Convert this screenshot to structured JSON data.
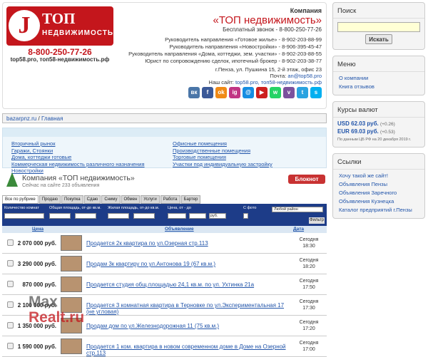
{
  "logo": {
    "top": "ТОП",
    "sub": "НЕДВИЖИМОСТЬ",
    "phone": "8-800-250-77-26",
    "sites": "top58.pro, топ58-недвижимость.рф"
  },
  "header": {
    "company_label": "Компания",
    "company_name": "«ТОП недвижимость»",
    "free_call": "Бесплатный звонок - 8-800-250-77-26",
    "staff": [
      "Руководитель направления «Готовое жилье» - 8-902-203-88-99",
      "Руководитель направления «Новостройки» - 8-906-395-45-47",
      "Руководитель направления «Дома, коттеджи, зем. участки» - 8-902-203-88-55",
      "Юрист по сопровождению сделок, ипотечный брокер - 8-902-203-38-77"
    ],
    "address": "г.Пенза, ул. Пушкина 15, 2-й этаж, офис 23",
    "mail_label": "Почта:",
    "mail": "an@top58.pro",
    "sites_label": "Наш сайт:",
    "sites": "top58.pro, топ58-недвижимость.рф",
    "social": [
      {
        "icon": "vk-icon",
        "label": "вк",
        "color": "#4a76a8"
      },
      {
        "icon": "facebook-icon",
        "label": "f",
        "color": "#3b5998"
      },
      {
        "icon": "odnoklassniki-icon",
        "label": "ok",
        "color": "#f08a16"
      },
      {
        "icon": "instagram-icon",
        "label": "ig",
        "color": "#c13584"
      },
      {
        "icon": "moimir-icon",
        "label": "@",
        "color": "#168de2"
      },
      {
        "icon": "youtube-icon",
        "label": "▶",
        "color": "#cd201f"
      },
      {
        "icon": "whatsapp-icon",
        "label": "w",
        "color": "#25d366"
      },
      {
        "icon": "viber-icon",
        "label": "v",
        "color": "#7b519d"
      },
      {
        "icon": "telegram-icon",
        "label": "t",
        "color": "#2aa3e0"
      },
      {
        "icon": "skype-icon",
        "label": "s",
        "color": "#00aff0"
      }
    ]
  },
  "breadcrumb": {
    "site": "bazarpnz.ru",
    "sep": "/",
    "page": "Главная"
  },
  "categories": {
    "left": [
      "Вторичный рынок",
      "Гаражи, Стоянки",
      "Дома, коттеджи готовые",
      "Коммерческая недвижимость различного назначения",
      "Новостройки"
    ],
    "right": [
      "Офисные помещения",
      "Производственные помещения",
      "Торговые помещения",
      "Участки под индивидуальную застройку"
    ]
  },
  "company": {
    "title": "Компания «ТОП недвижимость»",
    "count": "Сейчас на сайте 233 объявления",
    "block_btn": "Блокнот"
  },
  "tabs": [
    "Все по рубрике",
    "Продаю",
    "Покупка",
    "Сдаю",
    "Сниму",
    "Обмен",
    "Услуги",
    "Работа",
    "Бартер"
  ],
  "filter": {
    "rooms": "Количество комнат",
    "total_area": "Общая площадь, от-до кв.м.",
    "living_area": "Жилая площадь, от-до кв.м.",
    "price": "Цена, от - до",
    "photo": "С фото",
    "district": "Любой район",
    "currency": "руб.",
    "button": "Фильтр"
  },
  "columns": {
    "price": "Цена",
    "title": "Объявление",
    "date": "Дата"
  },
  "listings": [
    {
      "price": "2 070 000 руб.",
      "title": "Продается 2к квартира по ул.Озерная стр.113",
      "day": "Сегодня",
      "time": "18:30"
    },
    {
      "price": "3 290 000 руб.",
      "title": "Продам 3к квартиру по ул.Антонова 19 (67 кв.м.)",
      "day": "Сегодня",
      "time": "18:20"
    },
    {
      "price": "870 000 руб.",
      "title": "Продается студия общ.площадью 24,1 кв.м. по ул. Ухтинка 21а",
      "day": "Сегодня",
      "time": "17:50"
    },
    {
      "price": "2 100 000 руб.",
      "title": "Продается 3 комнатная квартира в Терновке по ул.Экспериментальная 17 (не угловая)",
      "day": "Сегодня",
      "time": "17:30"
    },
    {
      "price": "1 350 000 руб.",
      "title": "Продам дом по ул.Железнодорожная 11 (75 кв.м.)",
      "day": "Сегодня",
      "time": "17:20"
    },
    {
      "price": "1 590 000 руб.",
      "title": "Продается 1 ком. квартира в новом современном доме в Доме на Озерной стр.113",
      "day": "Сегодня",
      "time": "17:00"
    }
  ],
  "search": {
    "title": "Поиск",
    "button": "Искать"
  },
  "menu": {
    "title": "Меню",
    "items": [
      "О компании",
      "Книга отзывов"
    ]
  },
  "rates": {
    "title": "Курсы валют",
    "usd_label": "USD",
    "usd": "62.03 руб.",
    "usd_change": "(+0.26)",
    "eur_label": "EUR",
    "eur": "69.03 руб.",
    "eur_change": "(+0.53)",
    "note": "По данным ЦБ РФ на 20 декабря 2019 г."
  },
  "links": {
    "title": "Ссылки",
    "items": [
      "Хочу такой же сайт!",
      "Объявления Пензы",
      "Объявления Заречного",
      "Объявления Кузнецка",
      "Каталог предприятий г.Пензы"
    ]
  },
  "watermark": {
    "line1": "Max",
    "line2": "Realt.ru"
  }
}
